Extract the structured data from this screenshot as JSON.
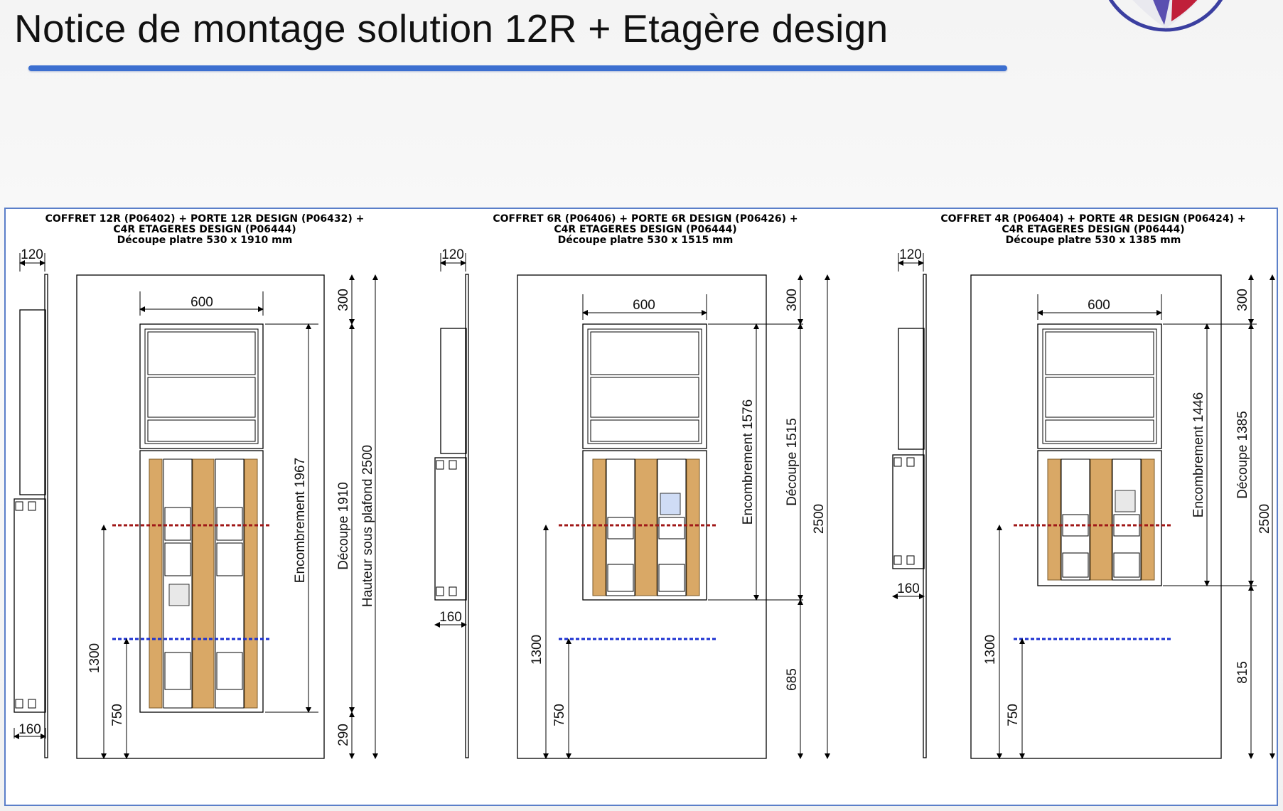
{
  "header": {
    "title": "Notice de montage solution 12R + Etagère design",
    "accent_color": "#3c6fd0",
    "logo_colors": [
      "#3b3fa0",
      "#c0203a"
    ]
  },
  "drawings": [
    {
      "caption_lines": [
        "COFFRET 12R (P06402) + PORTE 12R DESIGN (P06432) +",
        "C4R ETAGERES DESIGN (P06444)",
        "Découpe platre 530 x 1910 mm"
      ],
      "side_depth": "120",
      "side_bottom": "160",
      "width": "600",
      "top_gap": "300",
      "bottom_gap": "290",
      "encombrement": "Encombrement 1967",
      "decoupe": "Découpe 1910",
      "total": "Hauteur sous plafond 2500",
      "height_red": "1300",
      "height_blue": "750"
    },
    {
      "caption_lines": [
        "COFFRET 6R (P06406) + PORTE 6R DESIGN (P06426) +",
        "C4R ETAGERES DESIGN (P06444)",
        "Découpe platre 530 x 1515 mm"
      ],
      "side_depth": "120",
      "side_bottom": "160",
      "width": "600",
      "top_gap": "300",
      "bottom_gap": "685",
      "encombrement": "Encombrement 1576",
      "decoupe": "Découpe 1515",
      "total": "2500",
      "height_red": "1300",
      "height_blue": "750"
    },
    {
      "caption_lines": [
        "COFFRET 4R (P06404) + PORTE 4R DESIGN (P06424) +",
        "C4R ETAGERES DESIGN (P06444)",
        "Découpe platre 530 x 1385 mm"
      ],
      "side_depth": "120",
      "side_bottom": "160",
      "width": "600",
      "top_gap": "300",
      "bottom_gap": "815",
      "encombrement": "Encombrement 1446",
      "decoupe": "Découpe 1385",
      "total": "2500",
      "height_red": "1300",
      "height_blue": "750"
    }
  ],
  "colors": {
    "red_line": "#a01818",
    "blue_line": "#1a2fd0",
    "wood": "#d9a866"
  }
}
